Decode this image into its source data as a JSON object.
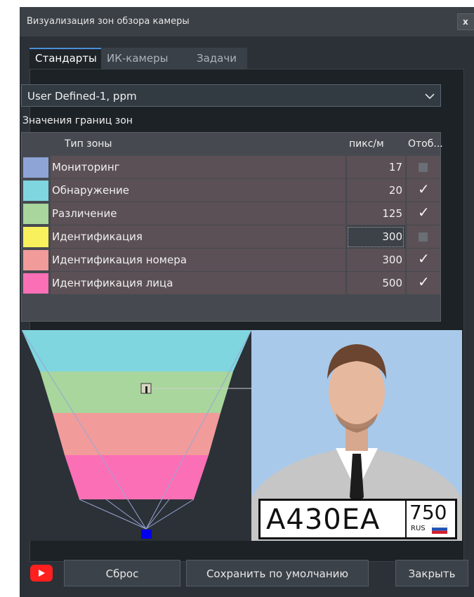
{
  "window": {
    "title": "Визуализация зон обзора камеры",
    "close_glyph": "x"
  },
  "tabs": [
    {
      "label": "Стандарты",
      "active": true
    },
    {
      "label": "ИК-камеры",
      "active": false
    },
    {
      "label": "Задачи",
      "active": false
    }
  ],
  "preset": {
    "value": "User Defined-1, ppm"
  },
  "zones": {
    "section_label": "Значения границ зон",
    "headers": {
      "type": "Тип зоны",
      "ppm": "пикс/м",
      "show": "Отоб..."
    },
    "rows": [
      {
        "name": "Мониторинг",
        "value": "17",
        "checked": false,
        "color": "#8ea4d6"
      },
      {
        "name": "Обнаружение",
        "value": "20",
        "checked": true,
        "color": "#7fd6df"
      },
      {
        "name": "Различение",
        "value": "125",
        "checked": true,
        "color": "#a8d69c"
      },
      {
        "name": "Идентификация",
        "value": "300",
        "checked": false,
        "color": "#f8f05c"
      },
      {
        "name": "Идентификация номера",
        "value": "300",
        "checked": true,
        "color": "#f19b9b"
      },
      {
        "name": "Идентификация лица",
        "value": "500",
        "checked": true,
        "color": "#fb6fb6"
      }
    ]
  },
  "plate": {
    "number": "А430ЕА",
    "region": "750",
    "country": "RUS"
  },
  "footer": {
    "youtube_icon": "youtube-icon",
    "reset_label": "Сброс",
    "save_default_label": "Сохранить по умолчанию",
    "close_label": "Закрыть"
  }
}
